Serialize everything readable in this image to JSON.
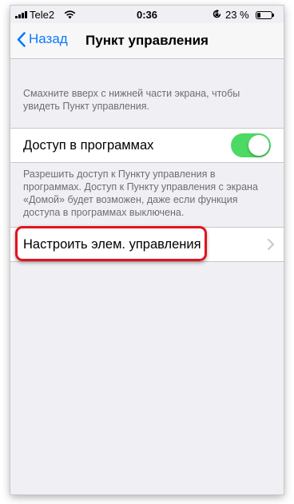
{
  "status_bar": {
    "carrier": "Tele2",
    "time": "0:36",
    "battery_percent": "23 %",
    "battery_level": 0.23,
    "icons": [
      "signal-icon",
      "wifi-icon",
      "orientation-lock-icon",
      "battery-icon"
    ]
  },
  "nav": {
    "back_label": "Назад",
    "title": "Пункт управления"
  },
  "section1": {
    "footer": "Смахните вверх с нижней части экрана, чтобы увидеть Пункт управления."
  },
  "access_cell": {
    "label": "Доступ в программах",
    "toggle_on": true
  },
  "section2": {
    "footer": "Разрешить доступ к Пункту управления в программах. Доступ к Пункту управления с экрана «Домой» будет возможен, даже если функция доступа в программах выключена."
  },
  "customize_cell": {
    "label": "Настроить элем. управления"
  },
  "colors": {
    "accent": "#0a7aff",
    "toggle_on": "#4cd964",
    "highlight": "#e0141d",
    "background": "#efeff4"
  }
}
